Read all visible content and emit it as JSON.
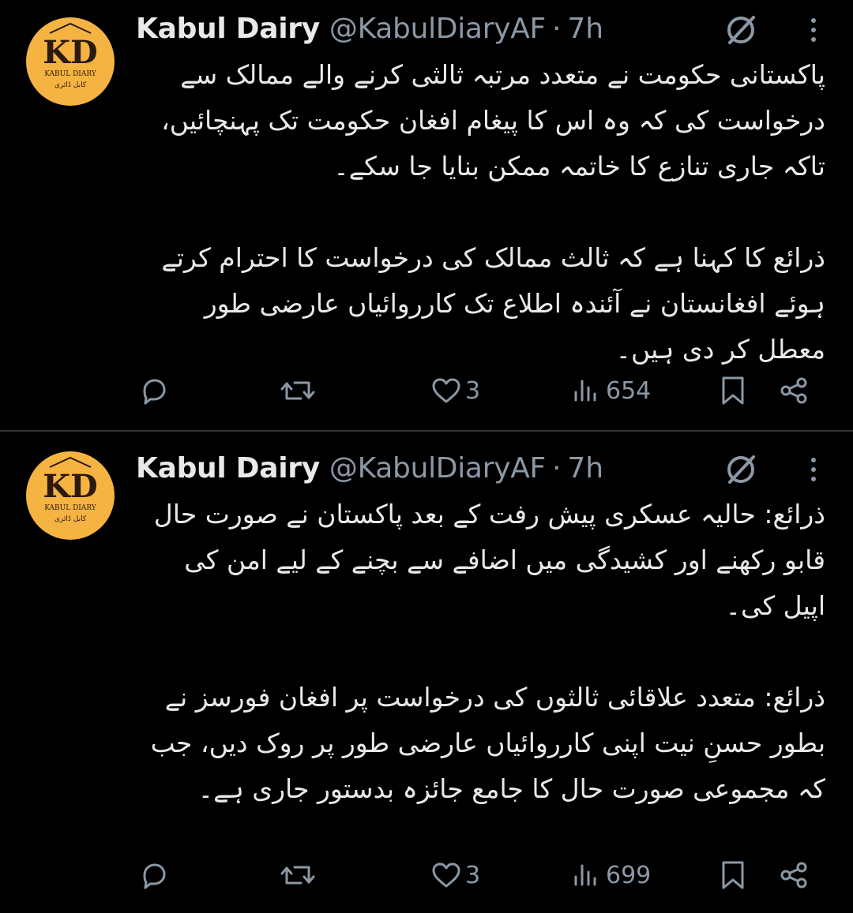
{
  "tweets": [
    {
      "author": {
        "name": "Kabul Dairy",
        "handle": "@KabulDiaryAF",
        "avatar": {
          "logo_letters": "KD",
          "logo_caption": "KABUL DIARY",
          "logo_caption_urdu": "کابل ڈائری"
        }
      },
      "separator": "·",
      "time": "7h",
      "paragraphs": [
        "پاکستانی حکومت نے متعدد مرتبہ ثالثی کرنے والے ممالک سے درخواست کی کہ وہ اس کا پیغام افغان حکومت تک پہنچائیں، تاکہ جاری تنازع کا خاتمہ ممکن بنایا جا سکے۔",
        "ذرائع کا کہنا ہے کہ ثالث ممالک کی درخواست کا احترام کرتے ہوئے افغانستان نے آئندہ اطلاع تک کارروائیاں عارضی طور معطل کر دی ہیں۔"
      ],
      "actions": {
        "reply_count": "",
        "repost_count": "",
        "like_count": "3",
        "view_count": "654"
      }
    },
    {
      "author": {
        "name": "Kabul Dairy",
        "handle": "@KabulDiaryAF",
        "avatar": {
          "logo_letters": "KD",
          "logo_caption": "KABUL DIARY",
          "logo_caption_urdu": "کابل ڈائری"
        }
      },
      "separator": "·",
      "time": "7h",
      "paragraphs": [
        "ذرائع: حالیہ عسکری پیش رفت کے بعد پاکستان نے صورت حال قابو رکھنے اور کشیدگی میں اضافے سے بچنے کے لیے امن کی اپیل کی۔",
        "ذرائع: متعدد علاقائی ثالثوں کی درخواست پر افغان فورسز نے بطور حسنِ نیت اپنی کارروائیاں عارضی طور پر روک دیں، جب کہ مجموعی صورت حال کا جامع جائزہ بدستور جاری ہے۔"
      ],
      "actions": {
        "reply_count": "",
        "repost_count": "",
        "like_count": "3",
        "view_count": "699"
      }
    }
  ],
  "colors": {
    "background": "#000000",
    "text": "#e7e9ea",
    "muted": "#8b98a5",
    "divider": "#2f3336",
    "avatar_bg": "#f5b342",
    "logo_dark": "#2b1a10"
  },
  "icons": [
    "grok-icon",
    "more-icon",
    "reply-icon",
    "repost-icon",
    "like-icon",
    "views-icon",
    "bookmark-icon",
    "share-icon"
  ]
}
